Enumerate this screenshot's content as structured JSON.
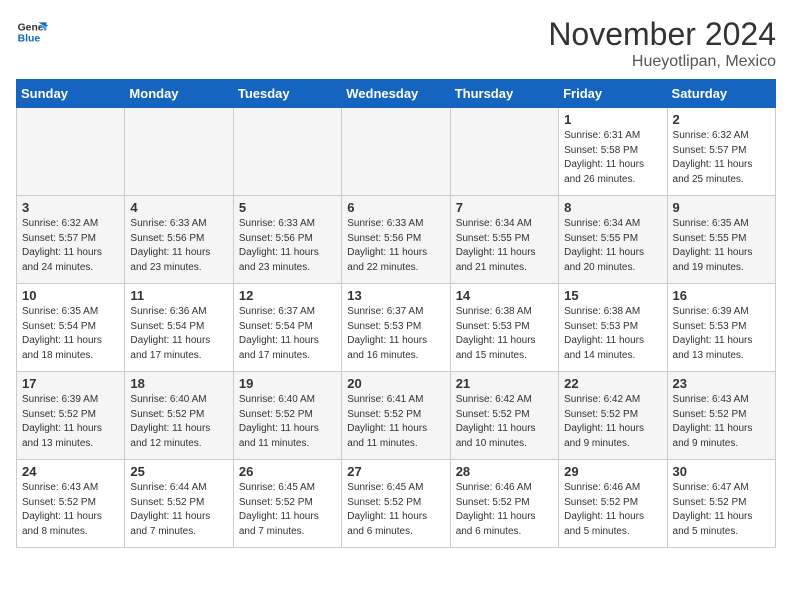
{
  "header": {
    "logo_general": "General",
    "logo_blue": "Blue",
    "month_title": "November 2024",
    "location": "Hueyotlipan, Mexico"
  },
  "days_of_week": [
    "Sunday",
    "Monday",
    "Tuesday",
    "Wednesday",
    "Thursday",
    "Friday",
    "Saturday"
  ],
  "weeks": [
    [
      {
        "day": "",
        "info": "",
        "empty": true
      },
      {
        "day": "",
        "info": "",
        "empty": true
      },
      {
        "day": "",
        "info": "",
        "empty": true
      },
      {
        "day": "",
        "info": "",
        "empty": true
      },
      {
        "day": "",
        "info": "",
        "empty": true
      },
      {
        "day": "1",
        "info": "Sunrise: 6:31 AM\nSunset: 5:58 PM\nDaylight: 11 hours\nand 26 minutes.",
        "empty": false
      },
      {
        "day": "2",
        "info": "Sunrise: 6:32 AM\nSunset: 5:57 PM\nDaylight: 11 hours\nand 25 minutes.",
        "empty": false
      }
    ],
    [
      {
        "day": "3",
        "info": "Sunrise: 6:32 AM\nSunset: 5:57 PM\nDaylight: 11 hours\nand 24 minutes.",
        "empty": false
      },
      {
        "day": "4",
        "info": "Sunrise: 6:33 AM\nSunset: 5:56 PM\nDaylight: 11 hours\nand 23 minutes.",
        "empty": false
      },
      {
        "day": "5",
        "info": "Sunrise: 6:33 AM\nSunset: 5:56 PM\nDaylight: 11 hours\nand 23 minutes.",
        "empty": false
      },
      {
        "day": "6",
        "info": "Sunrise: 6:33 AM\nSunset: 5:56 PM\nDaylight: 11 hours\nand 22 minutes.",
        "empty": false
      },
      {
        "day": "7",
        "info": "Sunrise: 6:34 AM\nSunset: 5:55 PM\nDaylight: 11 hours\nand 21 minutes.",
        "empty": false
      },
      {
        "day": "8",
        "info": "Sunrise: 6:34 AM\nSunset: 5:55 PM\nDaylight: 11 hours\nand 20 minutes.",
        "empty": false
      },
      {
        "day": "9",
        "info": "Sunrise: 6:35 AM\nSunset: 5:55 PM\nDaylight: 11 hours\nand 19 minutes.",
        "empty": false
      }
    ],
    [
      {
        "day": "10",
        "info": "Sunrise: 6:35 AM\nSunset: 5:54 PM\nDaylight: 11 hours\nand 18 minutes.",
        "empty": false
      },
      {
        "day": "11",
        "info": "Sunrise: 6:36 AM\nSunset: 5:54 PM\nDaylight: 11 hours\nand 17 minutes.",
        "empty": false
      },
      {
        "day": "12",
        "info": "Sunrise: 6:37 AM\nSunset: 5:54 PM\nDaylight: 11 hours\nand 17 minutes.",
        "empty": false
      },
      {
        "day": "13",
        "info": "Sunrise: 6:37 AM\nSunset: 5:53 PM\nDaylight: 11 hours\nand 16 minutes.",
        "empty": false
      },
      {
        "day": "14",
        "info": "Sunrise: 6:38 AM\nSunset: 5:53 PM\nDaylight: 11 hours\nand 15 minutes.",
        "empty": false
      },
      {
        "day": "15",
        "info": "Sunrise: 6:38 AM\nSunset: 5:53 PM\nDaylight: 11 hours\nand 14 minutes.",
        "empty": false
      },
      {
        "day": "16",
        "info": "Sunrise: 6:39 AM\nSunset: 5:53 PM\nDaylight: 11 hours\nand 13 minutes.",
        "empty": false
      }
    ],
    [
      {
        "day": "17",
        "info": "Sunrise: 6:39 AM\nSunset: 5:52 PM\nDaylight: 11 hours\nand 13 minutes.",
        "empty": false
      },
      {
        "day": "18",
        "info": "Sunrise: 6:40 AM\nSunset: 5:52 PM\nDaylight: 11 hours\nand 12 minutes.",
        "empty": false
      },
      {
        "day": "19",
        "info": "Sunrise: 6:40 AM\nSunset: 5:52 PM\nDaylight: 11 hours\nand 11 minutes.",
        "empty": false
      },
      {
        "day": "20",
        "info": "Sunrise: 6:41 AM\nSunset: 5:52 PM\nDaylight: 11 hours\nand 11 minutes.",
        "empty": false
      },
      {
        "day": "21",
        "info": "Sunrise: 6:42 AM\nSunset: 5:52 PM\nDaylight: 11 hours\nand 10 minutes.",
        "empty": false
      },
      {
        "day": "22",
        "info": "Sunrise: 6:42 AM\nSunset: 5:52 PM\nDaylight: 11 hours\nand 9 minutes.",
        "empty": false
      },
      {
        "day": "23",
        "info": "Sunrise: 6:43 AM\nSunset: 5:52 PM\nDaylight: 11 hours\nand 9 minutes.",
        "empty": false
      }
    ],
    [
      {
        "day": "24",
        "info": "Sunrise: 6:43 AM\nSunset: 5:52 PM\nDaylight: 11 hours\nand 8 minutes.",
        "empty": false
      },
      {
        "day": "25",
        "info": "Sunrise: 6:44 AM\nSunset: 5:52 PM\nDaylight: 11 hours\nand 7 minutes.",
        "empty": false
      },
      {
        "day": "26",
        "info": "Sunrise: 6:45 AM\nSunset: 5:52 PM\nDaylight: 11 hours\nand 7 minutes.",
        "empty": false
      },
      {
        "day": "27",
        "info": "Sunrise: 6:45 AM\nSunset: 5:52 PM\nDaylight: 11 hours\nand 6 minutes.",
        "empty": false
      },
      {
        "day": "28",
        "info": "Sunrise: 6:46 AM\nSunset: 5:52 PM\nDaylight: 11 hours\nand 6 minutes.",
        "empty": false
      },
      {
        "day": "29",
        "info": "Sunrise: 6:46 AM\nSunset: 5:52 PM\nDaylight: 11 hours\nand 5 minutes.",
        "empty": false
      },
      {
        "day": "30",
        "info": "Sunrise: 6:47 AM\nSunset: 5:52 PM\nDaylight: 11 hours\nand 5 minutes.",
        "empty": false
      }
    ]
  ]
}
